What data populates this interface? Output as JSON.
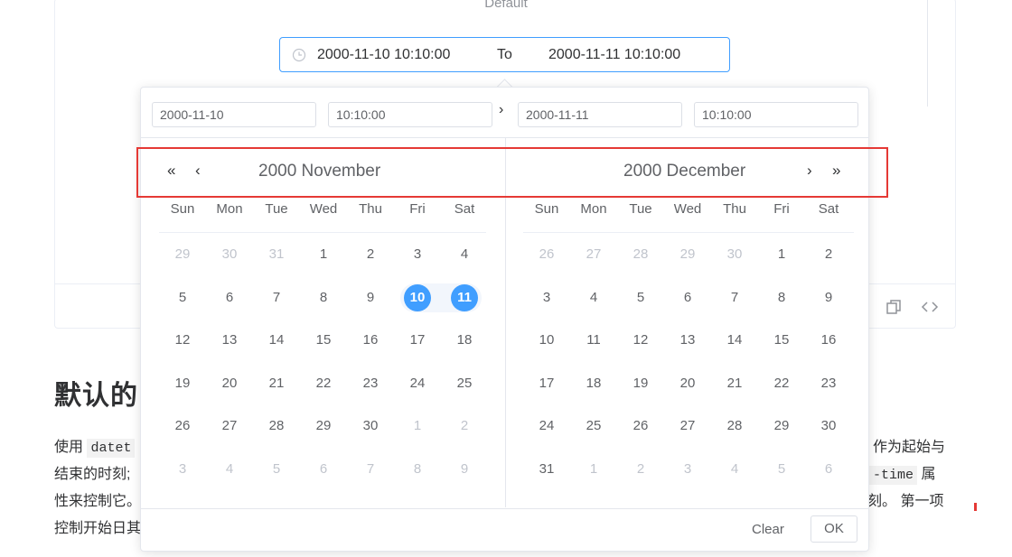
{
  "demo": {
    "label": "Default",
    "section_title": "默认的",
    "para_lines": [
      [
        "使用 ",
        "datet",
        "",
        "作为起始与"
      ],
      [
        "结束的时刻;",
        "",
        "",
        "-time",
        " 属"
      ],
      [
        "性来控制它。",
        "",
        "",
        "刻。 第一项"
      ],
      [
        "控制开始日其",
        "",
        "",
        ""
      ]
    ]
  },
  "range_input": {
    "start": "2000-11-10 10:10:00",
    "separator": "To",
    "end": "2000-11-11 10:10:00"
  },
  "time_header": {
    "start_date": "2000-11-10",
    "start_time": "10:10:00",
    "end_date": "2000-11-11",
    "end_time": "10:10:00"
  },
  "weekdays": [
    "Sun",
    "Mon",
    "Tue",
    "Wed",
    "Thu",
    "Fri",
    "Sat"
  ],
  "left_calendar": {
    "title": "2000 November",
    "weeks": [
      [
        "29",
        "30",
        "31",
        "1",
        "2",
        "3",
        "4"
      ],
      [
        "5",
        "6",
        "7",
        "8",
        "9",
        "10",
        "11"
      ],
      [
        "12",
        "13",
        "14",
        "15",
        "16",
        "17",
        "18"
      ],
      [
        "19",
        "20",
        "21",
        "22",
        "23",
        "24",
        "25"
      ],
      [
        "26",
        "27",
        "28",
        "29",
        "30",
        "1",
        "2"
      ],
      [
        "3",
        "4",
        "5",
        "6",
        "7",
        "8",
        "9"
      ]
    ],
    "other_month": [
      [
        0,
        0
      ],
      [
        0,
        1
      ],
      [
        0,
        2
      ],
      [
        4,
        5
      ],
      [
        4,
        6
      ],
      [
        5,
        0
      ],
      [
        5,
        1
      ],
      [
        5,
        2
      ],
      [
        5,
        3
      ],
      [
        5,
        4
      ],
      [
        5,
        5
      ],
      [
        5,
        6
      ]
    ],
    "selected": [
      [
        1,
        5
      ],
      [
        1,
        6
      ]
    ]
  },
  "right_calendar": {
    "title": "2000 December",
    "weeks": [
      [
        "26",
        "27",
        "28",
        "29",
        "30",
        "1",
        "2"
      ],
      [
        "3",
        "4",
        "5",
        "6",
        "7",
        "8",
        "9"
      ],
      [
        "10",
        "11",
        "12",
        "13",
        "14",
        "15",
        "16"
      ],
      [
        "17",
        "18",
        "19",
        "20",
        "21",
        "22",
        "23"
      ],
      [
        "24",
        "25",
        "26",
        "27",
        "28",
        "29",
        "30"
      ],
      [
        "31",
        "1",
        "2",
        "3",
        "4",
        "5",
        "6"
      ]
    ],
    "other_month": [
      [
        0,
        0
      ],
      [
        0,
        1
      ],
      [
        0,
        2
      ],
      [
        0,
        3
      ],
      [
        0,
        4
      ],
      [
        5,
        1
      ],
      [
        5,
        2
      ],
      [
        5,
        3
      ],
      [
        5,
        4
      ],
      [
        5,
        5
      ],
      [
        5,
        6
      ]
    ],
    "selected": []
  },
  "footer": {
    "clear": "Clear",
    "ok": "OK"
  },
  "icons": {
    "nav_prev_year": "«",
    "nav_prev_month": "‹",
    "nav_next_month": "›",
    "nav_next_year": "»",
    "mid_chevron": "›"
  },
  "colors": {
    "accent": "#409eff",
    "highlight": "#e53935",
    "range_bg": "#f2f6fc"
  }
}
